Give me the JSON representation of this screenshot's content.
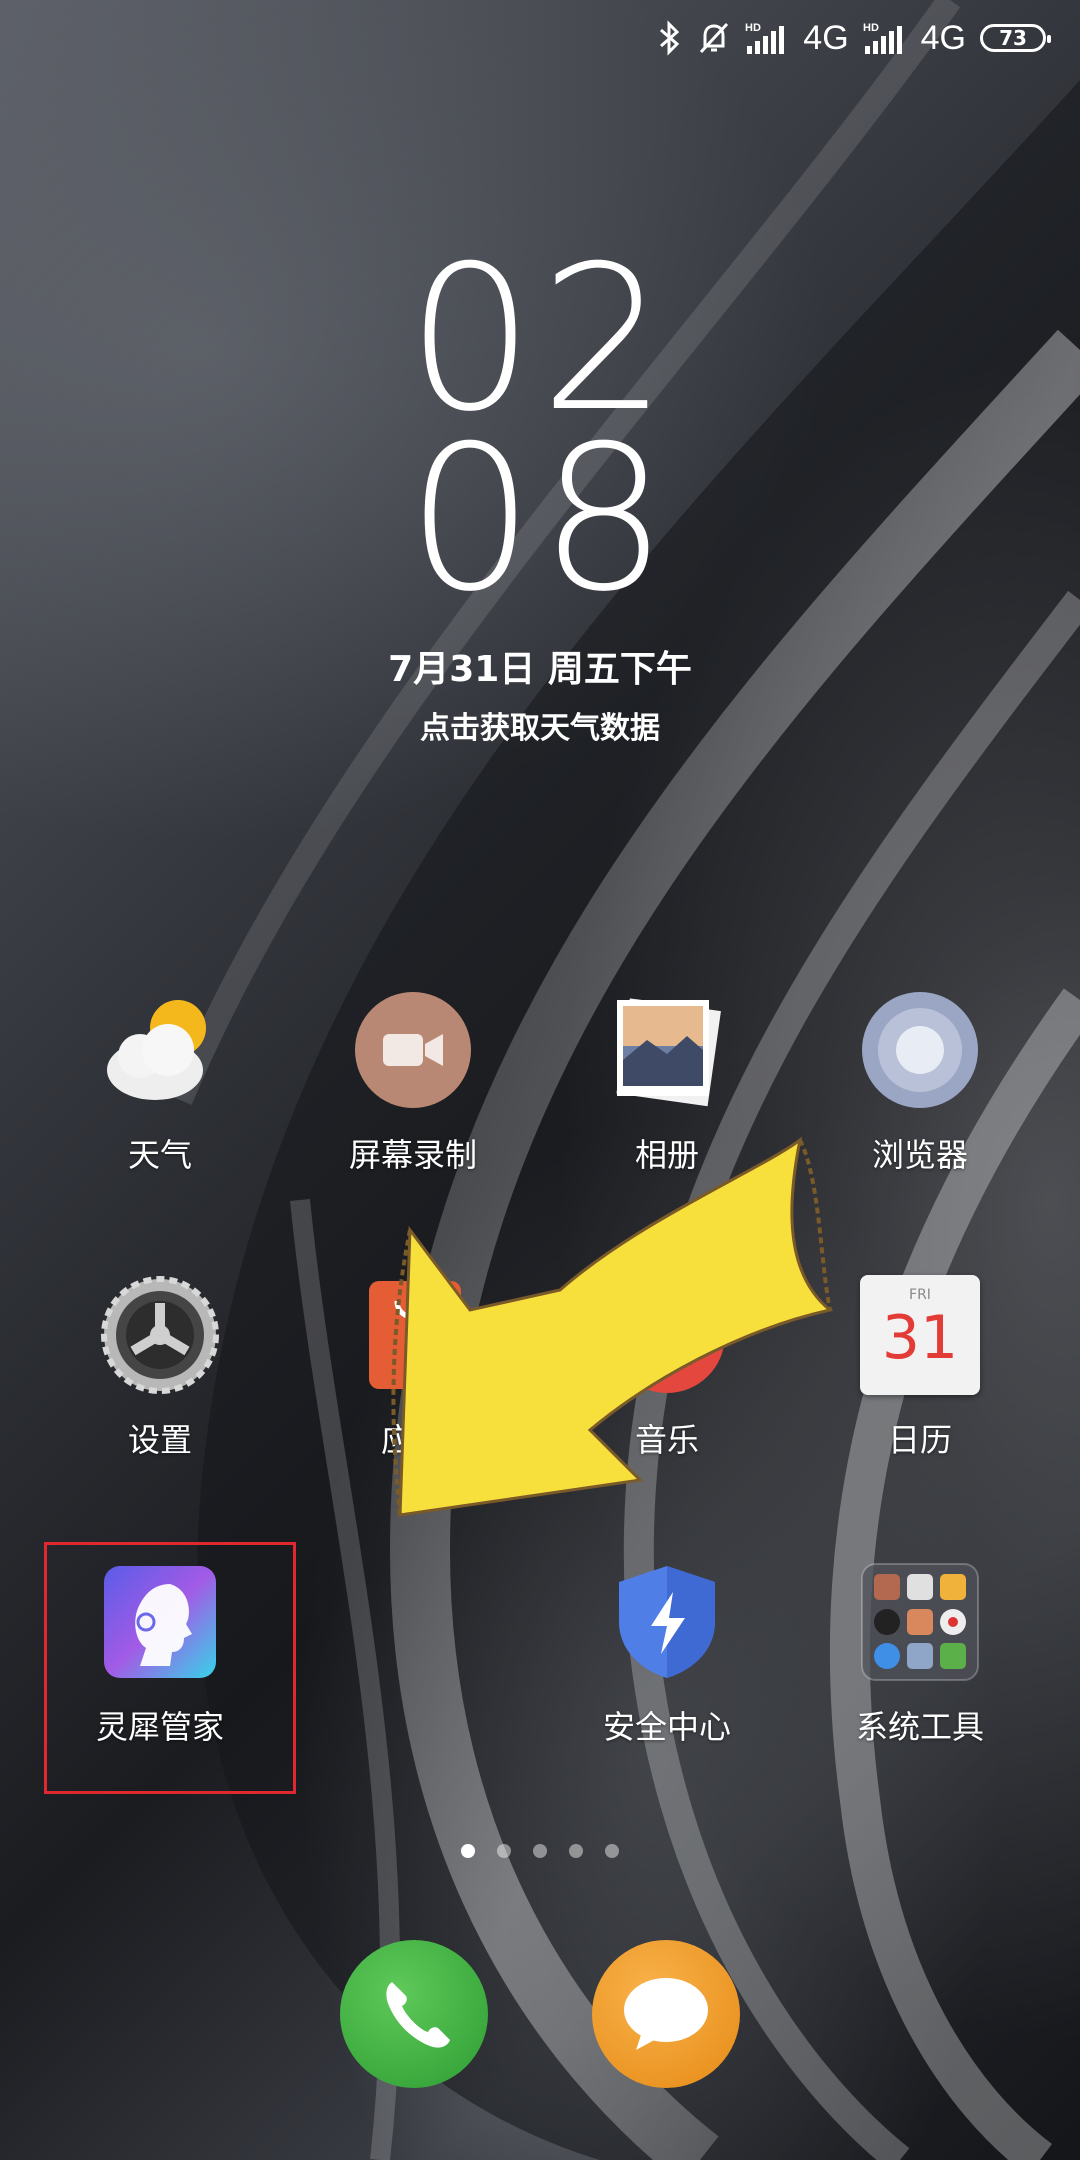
{
  "status_bar": {
    "icons": [
      "bluetooth-icon",
      "silent-bell-icon",
      "signal-hd-icon",
      "signal-hd-icon"
    ],
    "network_1": "4G",
    "network_2": "4G",
    "battery": "73"
  },
  "lockclock": {
    "hour": "02",
    "minute": "08",
    "date": "7月31日 周五下午",
    "weather_prompt": "点击获取天气数据"
  },
  "apps": [
    {
      "label": "天气",
      "icon": "weather-icon"
    },
    {
      "label": "屏幕录制",
      "icon": "screen-record-icon"
    },
    {
      "label": "相册",
      "icon": "gallery-icon"
    },
    {
      "label": "浏览器",
      "icon": "browser-icon"
    },
    {
      "label": "设置",
      "icon": "settings-gear-icon"
    },
    {
      "label": "应用",
      "icon": "app-store-icon"
    },
    {
      "label": "音乐",
      "icon": "music-icon"
    },
    {
      "label": "日历",
      "icon": "calendar-icon"
    },
    {
      "label": "灵犀管家",
      "icon": "lingxi-assistant-icon"
    },
    {
      "label": "安全中心",
      "icon": "security-center-icon"
    },
    {
      "label": "系统工具",
      "icon": "system-tools-folder-icon"
    }
  ],
  "calendar_icon": {
    "day_abbr": "FRI",
    "day_num": "31"
  },
  "page_indicator": {
    "pages": 5,
    "current": 1
  },
  "dock": [
    {
      "name": "phone",
      "icon": "phone-icon"
    },
    {
      "name": "messages",
      "icon": "message-icon"
    }
  ],
  "colors": {
    "highlight_box": "#e0282e",
    "arrow": "#f7e03c"
  }
}
